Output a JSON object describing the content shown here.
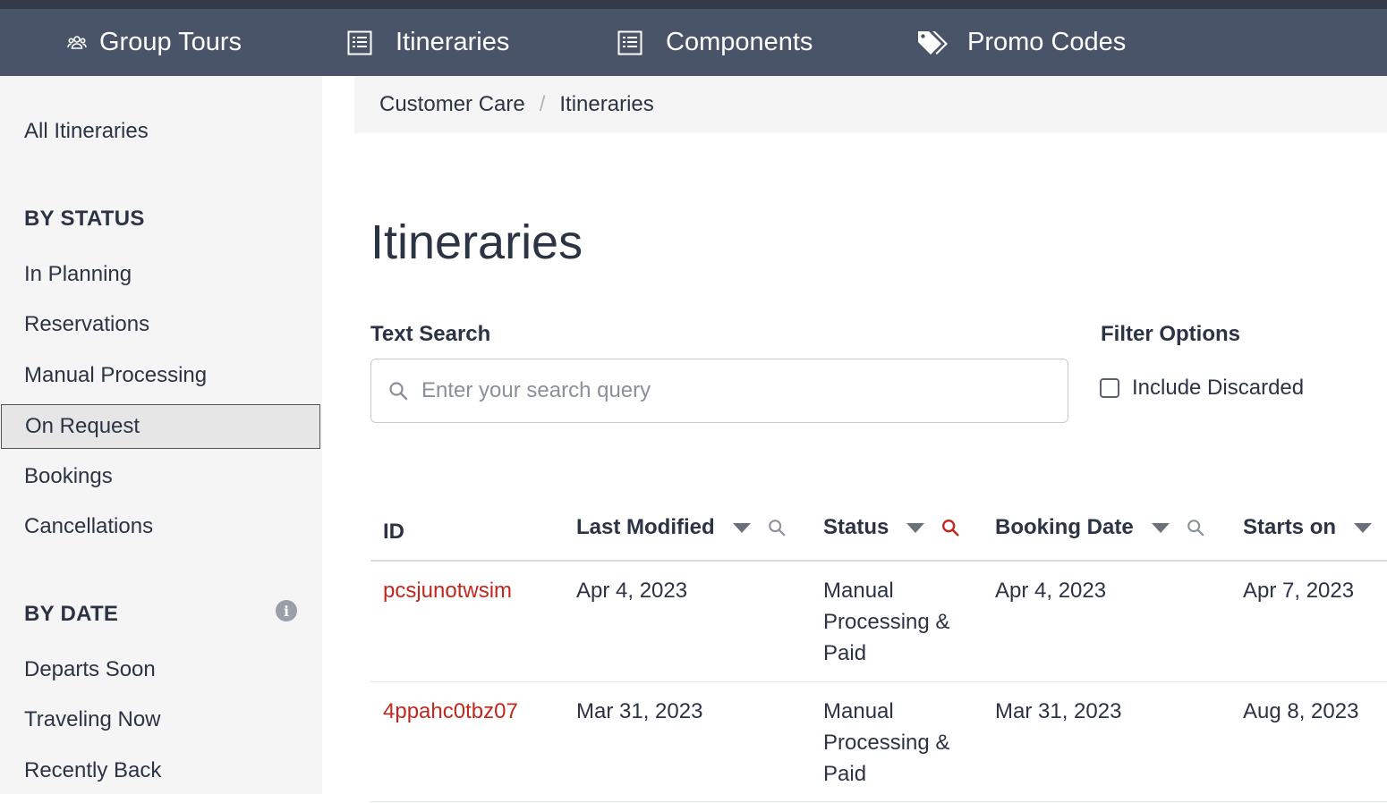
{
  "nav": {
    "items": [
      {
        "label": "Group Tours",
        "icon": "users-icon"
      },
      {
        "label": "Itineraries",
        "icon": "list-icon"
      },
      {
        "label": "Components",
        "icon": "list-icon"
      },
      {
        "label": "Promo Codes",
        "icon": "tags-icon"
      }
    ]
  },
  "sidebar": {
    "all_label": "All Itineraries",
    "by_status_heading": "BY STATUS",
    "status_items": [
      "In Planning",
      "Reservations",
      "Manual Processing",
      "On Request",
      "Bookings",
      "Cancellations"
    ],
    "active_item": "On Request",
    "by_date_heading": "BY DATE",
    "date_items": [
      "Departs Soon",
      "Traveling Now",
      "Recently Back"
    ]
  },
  "breadcrumb": {
    "items": [
      "Customer Care",
      "Itineraries"
    ]
  },
  "page": {
    "title": "Itineraries"
  },
  "search": {
    "label": "Text Search",
    "placeholder": "Enter your search query",
    "value": ""
  },
  "filter": {
    "label": "Filter Options",
    "include_discarded_label": "Include Discarded",
    "include_discarded_checked": false
  },
  "table": {
    "columns": [
      "ID",
      "Last Modified",
      "Status",
      "Booking Date",
      "Starts on"
    ],
    "active_search_color": "#c0281e",
    "rows": [
      {
        "id": "pcsjunotwsim",
        "last_modified": "Apr 4, 2023",
        "status": "Manual Processing & Paid",
        "booking_date": "Apr 4, 2023",
        "starts_on": "Apr 7, 2023"
      },
      {
        "id": "4ppahc0tbz07",
        "last_modified": "Mar 31, 2023",
        "status": "Manual Processing & Paid",
        "booking_date": "Mar 31, 2023",
        "starts_on": "Aug 8, 2023"
      }
    ]
  },
  "colors": {
    "topbar": "#4a5468",
    "link": "#c0281e",
    "text": "#2c3344"
  }
}
